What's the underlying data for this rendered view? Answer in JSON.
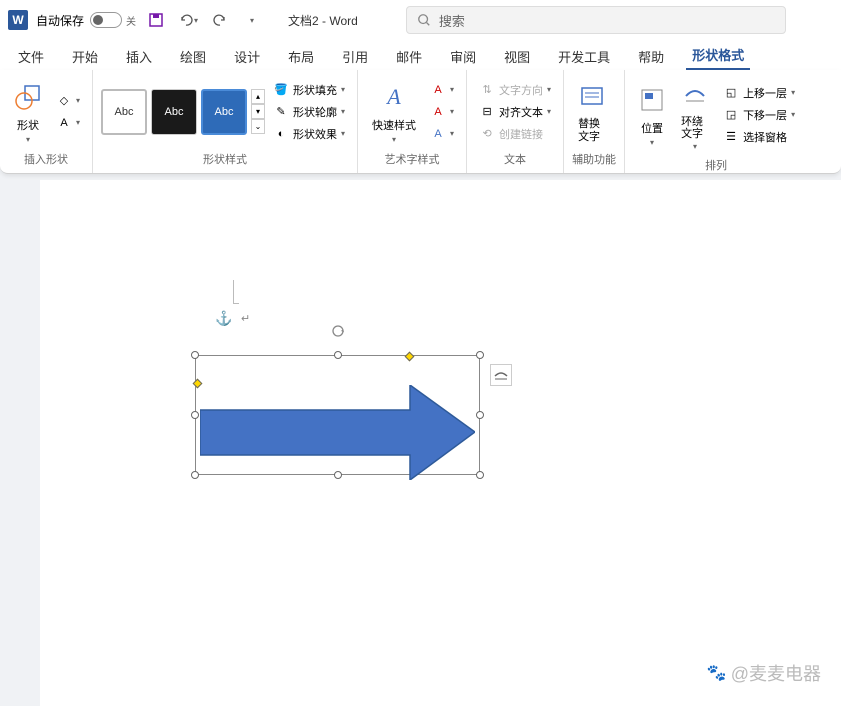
{
  "titlebar": {
    "autosave_label": "自动保存",
    "autosave_state": "关",
    "doc_title": "文档2  -  Word",
    "search_placeholder": "搜索"
  },
  "tabs": {
    "items": [
      "文件",
      "开始",
      "插入",
      "绘图",
      "设计",
      "布局",
      "引用",
      "邮件",
      "审阅",
      "视图",
      "开发工具",
      "帮助",
      "形状格式"
    ],
    "active_index": 12
  },
  "ribbon": {
    "insert_shape": {
      "label": "插入形状",
      "shapes_btn": "形状"
    },
    "shape_styles": {
      "label": "形状样式",
      "gallery": [
        "Abc",
        "Abc",
        "Abc"
      ],
      "fill": "形状填充",
      "outline": "形状轮廓",
      "effects": "形状效果"
    },
    "wordart": {
      "label": "艺术字样式",
      "quick": "快速样式"
    },
    "text": {
      "label": "文本",
      "direction": "文字方向",
      "align": "对齐文本",
      "link": "创建链接"
    },
    "accessibility": {
      "label": "辅助功能",
      "alt": "替换文字"
    },
    "arrange": {
      "label": "排列",
      "position": "位置",
      "wrap": "环绕文字",
      "forward": "上移一层",
      "backward": "下移一层",
      "pane": "选择窗格"
    }
  },
  "watermark": "@麦麦电器"
}
